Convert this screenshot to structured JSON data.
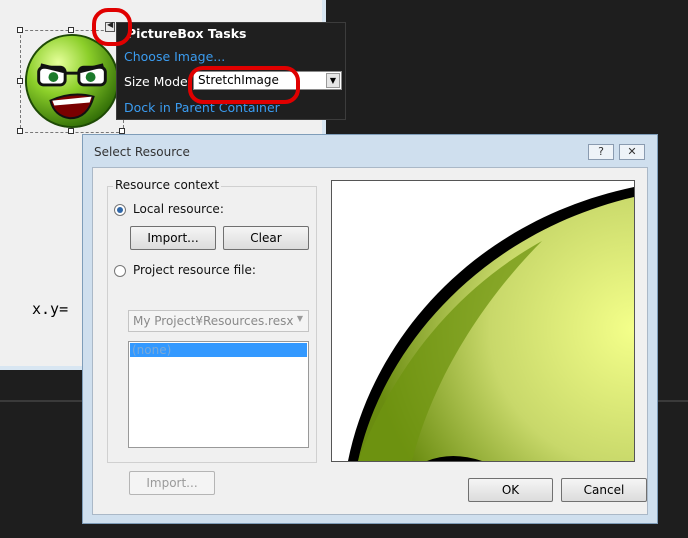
{
  "tasks": {
    "title": "PictureBox Tasks",
    "choose_image": "Choose Image...",
    "size_mode_label": "Size Mode:",
    "size_mode_value": "StretchImage",
    "dock_link": "Dock in Parent Container"
  },
  "form": {
    "label_text": "x.y="
  },
  "dialog": {
    "title": "Select Resource",
    "help_label": "?",
    "close_label": "✕",
    "group_title": "Resource context",
    "local_resource_label": "Local resource:",
    "import_label": "Import...",
    "clear_label": "Clear",
    "project_resource_label": "Project resource file:",
    "project_file": "My Project¥Resources.resx",
    "list_items": [
      "(none)"
    ],
    "import2_label": "Import...",
    "ok_label": "OK",
    "cancel_label": "Cancel"
  },
  "icons": {
    "smart_tag": "triangle-left-icon",
    "dropdown": "chevron-down-icon",
    "smiley": "angry-smiley-icon"
  },
  "colors": {
    "link": "#3b9cf0",
    "annotation": "#e00000",
    "selection": "#3399ff",
    "dialog_frame": "#cfdfee"
  }
}
